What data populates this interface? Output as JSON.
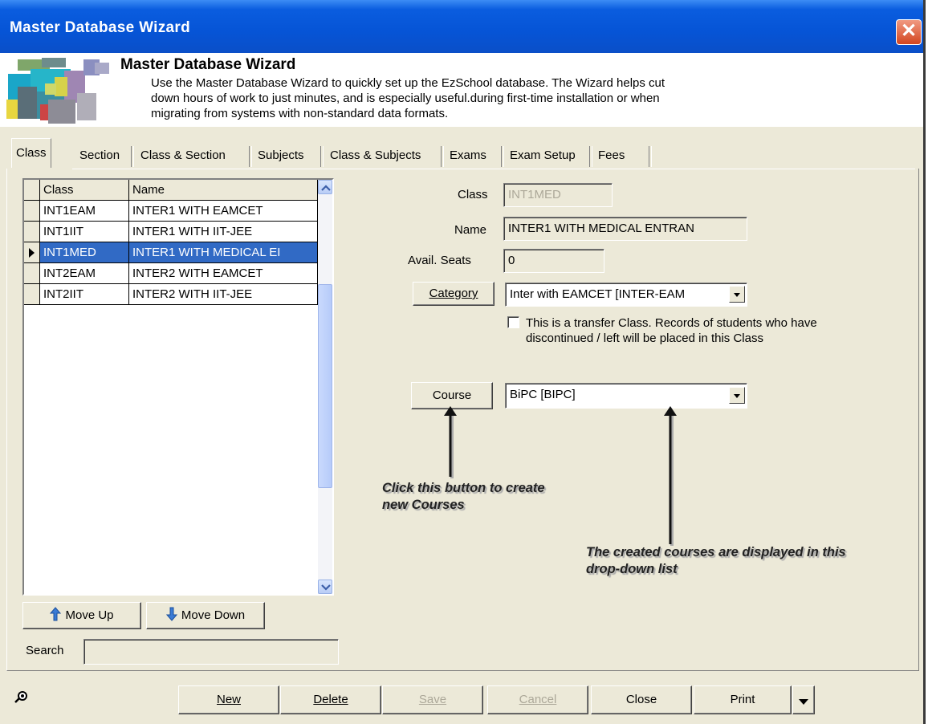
{
  "window": {
    "title": "Master Database Wizard",
    "close_label": "✕"
  },
  "banner": {
    "title": "Master Database Wizard",
    "description": "Use the Master Database Wizard to quickly set up the EzSchool database. The Wizard helps cut down hours of work to just minutes, and is especially useful.during first-time installation or when migrating from systems with non-standard data formats."
  },
  "tabs": [
    "Class",
    "Section",
    "Class & Section",
    "Subjects",
    "Class & Subjects",
    "Exams",
    "Exam Setup",
    "Fees"
  ],
  "grid": {
    "columns": [
      "Class",
      "Name"
    ],
    "rows": [
      {
        "class": "INT1EAM",
        "name": "INTER1 WITH EAMCET"
      },
      {
        "class": "INT1IIT",
        "name": "INTER1 WITH IIT-JEE"
      },
      {
        "class": "INT1MED",
        "name": "INTER1 WITH MEDICAL EI"
      },
      {
        "class": "INT2EAM",
        "name": "INTER2 WITH EAMCET"
      },
      {
        "class": "INT2IIT",
        "name": "INTER2 WITH IIT-JEE"
      }
    ]
  },
  "move": {
    "up": "Move Up",
    "down": "Move Down"
  },
  "search": {
    "label": "Search",
    "value": ""
  },
  "form": {
    "class_label": "Class",
    "class_value": "INT1MED",
    "name_label": "Name",
    "name_value": "INTER1 WITH MEDICAL ENTRAN",
    "seats_label": "Avail. Seats",
    "seats_value": "0",
    "category_button": "Category",
    "category_value": "Inter with EAMCET [INTER-EAM",
    "transfer_text": "This is a transfer Class. Records of students who have discontinued / left will be placed in this Class",
    "course_button": "Course",
    "course_value": "BiPC [BIPC]"
  },
  "annotations": {
    "button_note": "Click this button to create new Courses",
    "dropdown_note": "The created courses are displayed in this drop-down list"
  },
  "footer": {
    "new": "New",
    "delete": "Delete",
    "save": "Save",
    "cancel": "Cancel",
    "close": "Close",
    "print": "Print"
  }
}
